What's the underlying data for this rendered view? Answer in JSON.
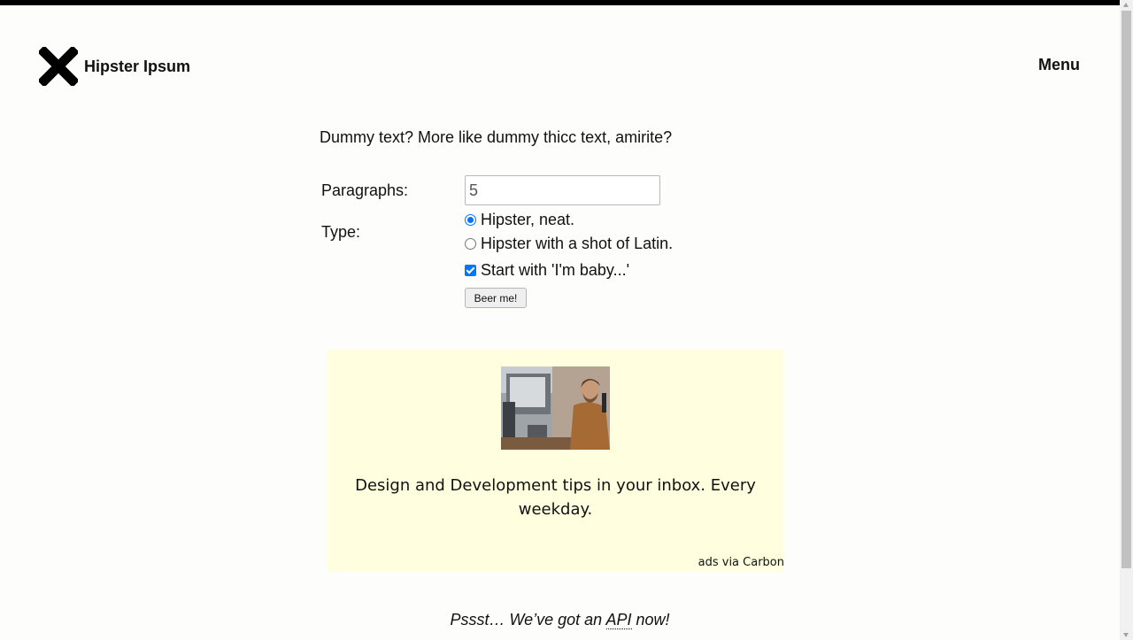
{
  "header": {
    "site_name": "Hipster Ipsum",
    "menu_label": "Menu"
  },
  "main": {
    "tagline": "Dummy text? More like dummy thicc text, amirite?"
  },
  "form": {
    "paragraphs_label": "Paragraphs:",
    "paragraphs_value": "5",
    "type_label": "Type:",
    "options": [
      {
        "label": "Hipster, neat.",
        "selected": true
      },
      {
        "label": "Hipster with a shot of Latin.",
        "selected": false
      }
    ],
    "start_with_label": "Start with 'I'm baby...'",
    "start_with_checked": true,
    "submit_label": "Beer me!"
  },
  "ad": {
    "text": "Design and Development tips in your inbox. Every weekday.",
    "via": "ads via Carbon"
  },
  "footer": {
    "api_prefix": "Pssst… We’ve got an ",
    "api_link": "API",
    "api_suffix": " now!"
  },
  "colors": {
    "accent": "#0075ff",
    "ad_background": "#ffffe0",
    "top_bar": "#000000"
  },
  "icons": {
    "logo": "x-mark-icon"
  }
}
